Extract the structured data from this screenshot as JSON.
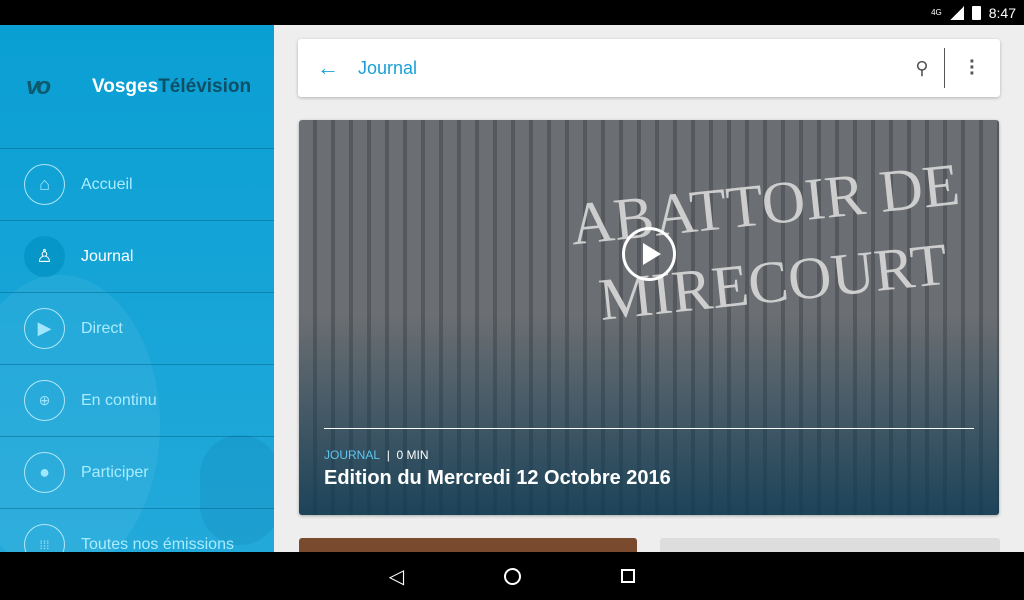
{
  "status": {
    "network": "4G",
    "time": "8:47"
  },
  "drawer": {
    "logo": "vo",
    "brand_a": "Vosges",
    "brand_b": "Télévision",
    "items": [
      {
        "label": "Accueil",
        "icon": "home-icon"
      },
      {
        "label": "Journal",
        "icon": "journal-icon",
        "active": true
      },
      {
        "label": "Direct",
        "icon": "play-icon"
      },
      {
        "label": "En continu",
        "icon": "globe-icon"
      },
      {
        "label": "Participer",
        "icon": "chat-icon"
      },
      {
        "label": "Toutes nos émissions",
        "icon": "grid-icon"
      }
    ]
  },
  "toolbar": {
    "title": "Journal"
  },
  "featured": {
    "photo_lettering": "ABATTOIR DE MIRECOURT",
    "category": "JOURNAL",
    "separator": "|",
    "duration": "0 MIN",
    "title": "Edition du Mercredi 12 Octobre 2016"
  },
  "colors": {
    "accent": "#1a9fd6",
    "drawer": "#0a9fd3"
  }
}
